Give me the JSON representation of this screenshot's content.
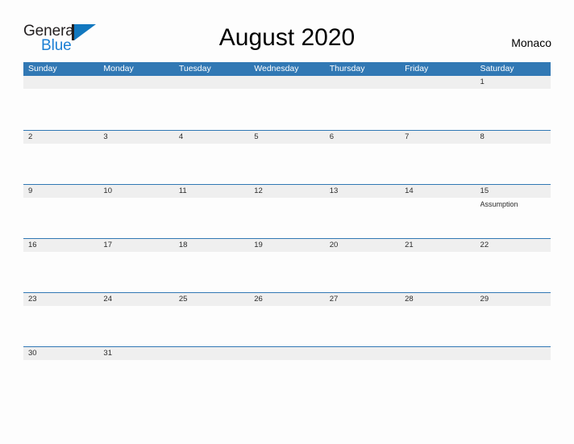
{
  "brand": {
    "name_part1": "General",
    "name_part2": "Blue",
    "logo_icon": "triangle-flag-icon"
  },
  "header": {
    "title": "August 2020",
    "region": "Monaco"
  },
  "calendar": {
    "weekdays": [
      "Sunday",
      "Monday",
      "Tuesday",
      "Wednesday",
      "Thursday",
      "Friday",
      "Saturday"
    ],
    "accent_color": "#3178b4",
    "day_strip_color": "#efefef",
    "weeks": [
      {
        "days": [
          {
            "num": "",
            "events": []
          },
          {
            "num": "",
            "events": []
          },
          {
            "num": "",
            "events": []
          },
          {
            "num": "",
            "events": []
          },
          {
            "num": "",
            "events": []
          },
          {
            "num": "",
            "events": []
          },
          {
            "num": "1",
            "events": []
          }
        ]
      },
      {
        "days": [
          {
            "num": "2",
            "events": []
          },
          {
            "num": "3",
            "events": []
          },
          {
            "num": "4",
            "events": []
          },
          {
            "num": "5",
            "events": []
          },
          {
            "num": "6",
            "events": []
          },
          {
            "num": "7",
            "events": []
          },
          {
            "num": "8",
            "events": []
          }
        ]
      },
      {
        "days": [
          {
            "num": "9",
            "events": []
          },
          {
            "num": "10",
            "events": []
          },
          {
            "num": "11",
            "events": []
          },
          {
            "num": "12",
            "events": []
          },
          {
            "num": "13",
            "events": []
          },
          {
            "num": "14",
            "events": []
          },
          {
            "num": "15",
            "events": [
              "Assumption"
            ]
          }
        ]
      },
      {
        "days": [
          {
            "num": "16",
            "events": []
          },
          {
            "num": "17",
            "events": []
          },
          {
            "num": "18",
            "events": []
          },
          {
            "num": "19",
            "events": []
          },
          {
            "num": "20",
            "events": []
          },
          {
            "num": "21",
            "events": []
          },
          {
            "num": "22",
            "events": []
          }
        ]
      },
      {
        "days": [
          {
            "num": "23",
            "events": []
          },
          {
            "num": "24",
            "events": []
          },
          {
            "num": "25",
            "events": []
          },
          {
            "num": "26",
            "events": []
          },
          {
            "num": "27",
            "events": []
          },
          {
            "num": "28",
            "events": []
          },
          {
            "num": "29",
            "events": []
          }
        ]
      },
      {
        "days": [
          {
            "num": "30",
            "events": []
          },
          {
            "num": "31",
            "events": []
          },
          {
            "num": "",
            "events": []
          },
          {
            "num": "",
            "events": []
          },
          {
            "num": "",
            "events": []
          },
          {
            "num": "",
            "events": []
          },
          {
            "num": "",
            "events": []
          }
        ]
      }
    ]
  }
}
